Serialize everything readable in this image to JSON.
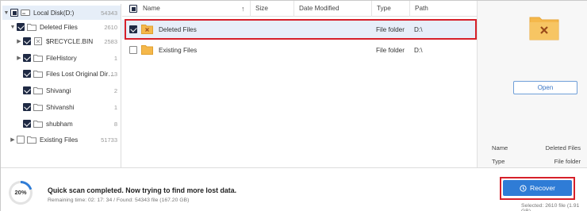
{
  "tree": {
    "items": [
      {
        "label": "Local Disk(D:)",
        "count": "54343",
        "expander": "▼",
        "check": "partial",
        "icon": "drive-icon"
      },
      {
        "label": "Deleted Files",
        "count": "2610",
        "expander": "▼",
        "check": "checked",
        "icon": "deleted-folder-icon"
      },
      {
        "label": "$RECYCLE.BIN",
        "count": "2583",
        "expander": "▶",
        "check": "checked",
        "icon": "recycle-bin-icon"
      },
      {
        "label": "FileHistory",
        "count": "1",
        "expander": "▶",
        "check": "checked",
        "icon": "folder-icon"
      },
      {
        "label": "Files Lost Original Direct...",
        "count": "13",
        "expander": "",
        "check": "checked",
        "icon": "folder-icon"
      },
      {
        "label": "Shivangi",
        "count": "2",
        "expander": "",
        "check": "checked",
        "icon": "folder-icon"
      },
      {
        "label": "Shivanshi",
        "count": "1",
        "expander": "",
        "check": "checked",
        "icon": "folder-icon"
      },
      {
        "label": "shubham",
        "count": "8",
        "expander": "",
        "check": "checked",
        "icon": "folder-icon"
      },
      {
        "label": "Existing Files",
        "count": "51733",
        "expander": "▶",
        "check": "unchecked",
        "icon": "folder-icon"
      }
    ]
  },
  "list": {
    "columns": {
      "name": "Name",
      "size": "Size",
      "date": "Date Modified",
      "type": "Type",
      "path": "Path"
    },
    "sort_indicator": "↑",
    "rows": [
      {
        "name": "Deleted Files",
        "size": "",
        "date": "",
        "type": "File folder",
        "path": "D:\\",
        "checked": true
      },
      {
        "name": "Existing Files",
        "size": "",
        "date": "",
        "type": "File folder",
        "path": "D:\\",
        "checked": false
      }
    ]
  },
  "details": {
    "open_label": "Open",
    "name_label": "Name",
    "name_value": "Deleted Files",
    "type_label": "Type",
    "type_value": "File folder"
  },
  "status": {
    "progress_text": "20%",
    "progress_value": 0.2,
    "message": "Quick scan completed. Now trying to find more lost data.",
    "sub": "Remaining time: 02: 17: 34 / Found: 54343 file (167.20 GB)",
    "recover_label": "Recover",
    "selected_text": "Selected: 2610 file (1.91 GB)"
  },
  "colors": {
    "accent": "#2f7cd6",
    "highlight_box": "#d6202a",
    "folder": "#f5b84b",
    "selection": "#e7eef9"
  }
}
